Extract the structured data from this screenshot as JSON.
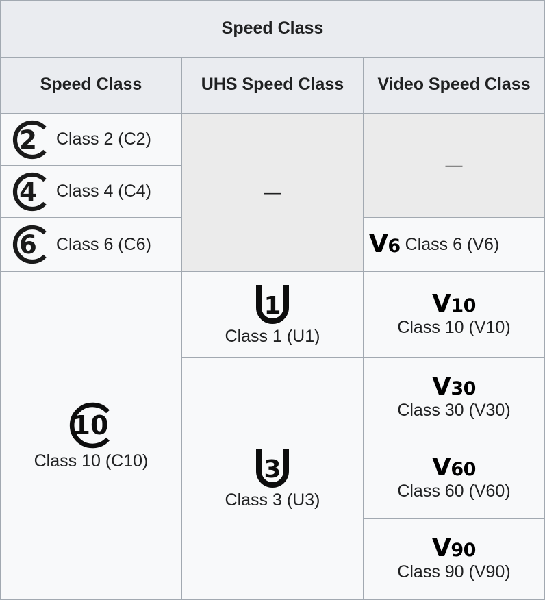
{
  "table": {
    "caption": "Speed Class",
    "columns": [
      {
        "key": "speed_class",
        "label": "Speed Class"
      },
      {
        "key": "uhs_speed_class",
        "label": "UHS Speed Class"
      },
      {
        "key": "video_speed_class",
        "label": "Video Speed Class"
      }
    ],
    "empty_marker": "—",
    "colors": {
      "header_background": "#eaecf0",
      "cell_background": "#f8f9fa",
      "empty_cell_background": "#ebebeb",
      "border": "#a2a9b1",
      "text": "#202122",
      "icon": "#000000"
    },
    "speed_class_rows": [
      {
        "icon": "c2-speed-class-icon",
        "icon_number": "2",
        "label": "Class 2 (C2)"
      },
      {
        "icon": "c4-speed-class-icon",
        "icon_number": "4",
        "label": "Class 4 (C4)"
      },
      {
        "icon": "c6-speed-class-icon",
        "icon_number": "6",
        "label": "Class 6 (C6)"
      },
      {
        "icon": "c10-speed-class-icon",
        "icon_number": "10",
        "label": "Class 10 (C10)"
      }
    ],
    "uhs_speed_class_rows": [
      {
        "icon": "u1-uhs-speed-class-icon",
        "icon_number": "1",
        "label": "Class 1 (U1)"
      },
      {
        "icon": "u3-uhs-speed-class-icon",
        "icon_number": "3",
        "label": "Class 3 (U3)"
      }
    ],
    "video_speed_class_rows": [
      {
        "icon": "v6-video-speed-class-icon",
        "icon_letter": "V",
        "icon_number": "6",
        "label": "Class 6 (V6)"
      },
      {
        "icon": "v10-video-speed-class-icon",
        "icon_letter": "V",
        "icon_number": "10",
        "label": "Class 10 (V10)"
      },
      {
        "icon": "v30-video-speed-class-icon",
        "icon_letter": "V",
        "icon_number": "30",
        "label": "Class 30 (V30)"
      },
      {
        "icon": "v60-video-speed-class-icon",
        "icon_letter": "V",
        "icon_number": "60",
        "label": "Class 60 (V60)"
      },
      {
        "icon": "v90-video-speed-class-icon",
        "icon_letter": "V",
        "icon_number": "90",
        "label": "Class 90 (V90)"
      }
    ]
  }
}
